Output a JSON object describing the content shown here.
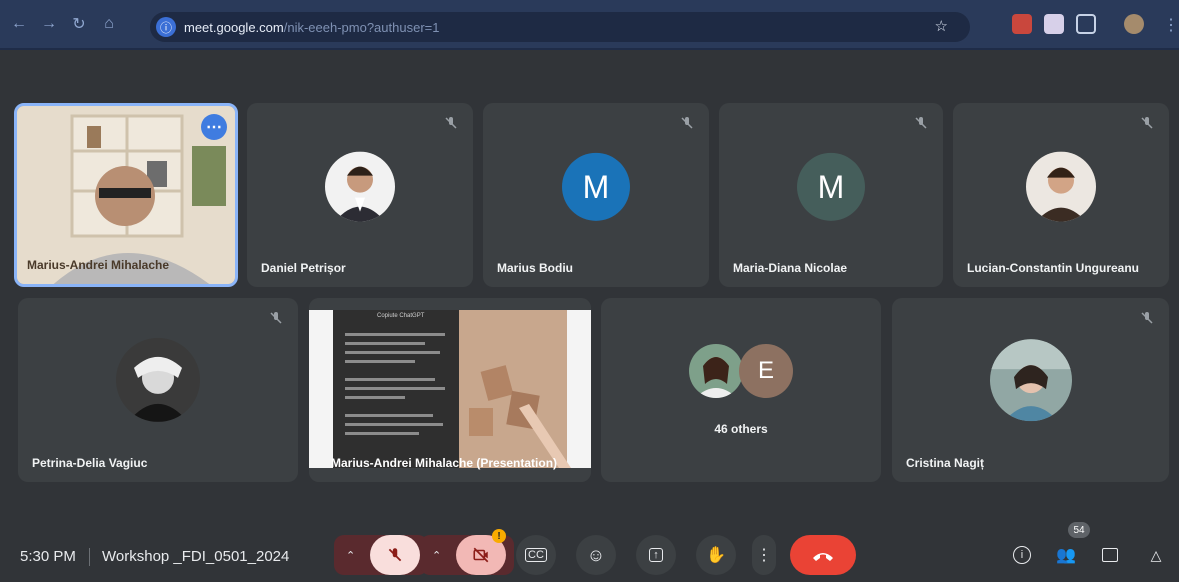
{
  "browser": {
    "url_host": "meet.google.com",
    "url_path": "/nik-eeeh-pmo?authuser=1"
  },
  "tiles_row1": [
    {
      "name": "Marius-Andrei Mihalache",
      "kind": "video"
    },
    {
      "name": "Daniel Petrișor",
      "kind": "photo"
    },
    {
      "name": "Marius Bodiu",
      "kind": "letter",
      "letter": "M",
      "color": "#1a73b8"
    },
    {
      "name": "Maria-Diana Nicolae",
      "kind": "letter",
      "letter": "M",
      "color": "#455e5b"
    },
    {
      "name": "Lucian-Constantin Ungureanu",
      "kind": "photo"
    }
  ],
  "tiles_row2": [
    {
      "name": "Petrina-Delia Vagiuc",
      "kind": "photo"
    },
    {
      "name": "Marius-Andrei Mihalache (Presentation)",
      "kind": "presentation",
      "slide_title": "Copiute ChatGPT"
    },
    {
      "name": "",
      "kind": "others",
      "others_label": "46 others",
      "letter": "E"
    },
    {
      "name": "Cristina Nagiț",
      "kind": "photo"
    }
  ],
  "bottom": {
    "time": "5:30 PM",
    "meeting_name": "Workshop _FDI_0501_2024",
    "participant_count": "54"
  },
  "colors": {
    "end_call": "#ea4335",
    "mic_off_bg": "#f9dedc",
    "accent": "#8ab4f8"
  },
  "icons": [
    "mic-off-icon",
    "camera-off-icon",
    "captions-icon",
    "emoji-icon",
    "present-icon",
    "raise-hand-icon",
    "more-options-icon",
    "end-call-icon",
    "info-icon",
    "people-icon",
    "chat-icon",
    "activities-icon"
  ]
}
